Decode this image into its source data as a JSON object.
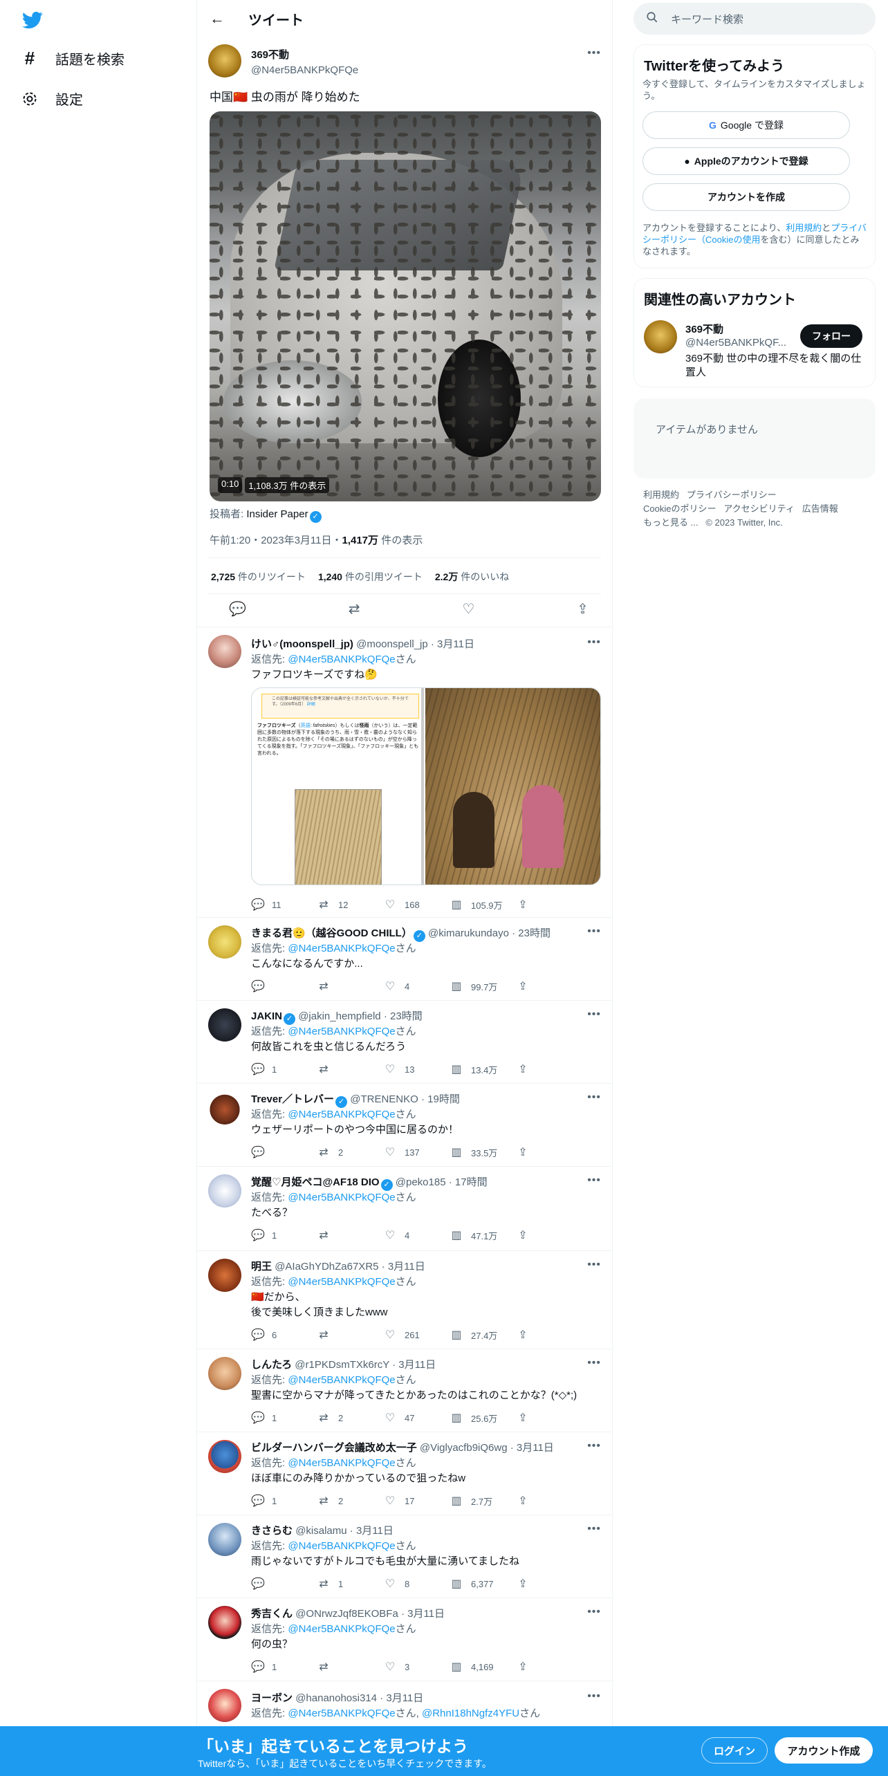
{
  "nav": {
    "explore": "話題を検索",
    "settings": "設定"
  },
  "header": {
    "title": "ツイート"
  },
  "main_tweet": {
    "name": "369不動",
    "handle": "@N4er5BANKPkQFQe",
    "text": "中国🇨🇳 虫の雨が 降り始めた",
    "video_time": "0:10",
    "video_views": "1,108.3万 件の表示",
    "poster_label": "投稿者: ",
    "poster_name": "Insider Paper",
    "timestamp": "午前1:20・2023年3月11日・",
    "views_num": "1,417万",
    "views_label": " 件の表示",
    "retweets_num": "2,725",
    "retweets_label": " 件のリツイート",
    "quotes_num": "1,240",
    "quotes_label": " 件の引用ツイート",
    "likes_num": "2.2万",
    "likes_label": " 件のいいね"
  },
  "reply_prefix": "返信先: ",
  "reply_suffix": "さん",
  "replies": [
    {
      "name": "けい♂(moonspell_jp)",
      "handle": "@moonspell_jp",
      "date": "· 3月11日",
      "reply_to": "@N4er5BANKPkQFQe",
      "text": "ファフロツキーズですね🤔",
      "replies": "11",
      "retweets": "12",
      "likes": "168",
      "views": "105.9万"
    },
    {
      "name": "きまる君🫡（越谷GOOD CHILL）",
      "handle": "@kimarukundayo",
      "date": "· 23時間",
      "reply_to": "@N4er5BANKPkQFQe",
      "text": "こんなになるんですか...",
      "replies": "",
      "retweets": "",
      "likes": "4",
      "views": "99.7万"
    },
    {
      "name": "JAKIN",
      "handle": "@jakin_hempfield",
      "date": "· 23時間",
      "reply_to": "@N4er5BANKPkQFQe",
      "text": "何故皆これを虫と信じるんだろう",
      "replies": "1",
      "retweets": "",
      "likes": "13",
      "views": "13.4万"
    },
    {
      "name": "Trever／トレバー",
      "handle": "@TRENENKO",
      "date": "· 19時間",
      "reply_to": "@N4er5BANKPkQFQe",
      "text": "ウェザーリポートのやつ今中国に居るのか！",
      "replies": "",
      "retweets": "2",
      "likes": "137",
      "views": "33.5万"
    },
    {
      "name": "覚醒♡月姫ペコ@AF18 DIO",
      "handle": "@peko185",
      "date": "· 17時間",
      "reply_to": "@N4er5BANKPkQFQe",
      "text": "たべる？",
      "replies": "1",
      "retweets": "",
      "likes": "4",
      "views": "47.1万"
    },
    {
      "name": "明王",
      "handle": "@AIaGhYDhZa67XR5",
      "date": "· 3月11日",
      "reply_to": "@N4er5BANKPkQFQe",
      "text": "🇨🇳だから、",
      "text2": "後で美味しく頂きましたwww",
      "replies": "6",
      "retweets": "",
      "likes": "261",
      "views": "27.4万"
    },
    {
      "name": "しんたろ",
      "handle": "@r1PKDsmTXk6rcY",
      "date": "· 3月11日",
      "reply_to": "@N4er5BANKPkQFQe",
      "text": "聖書に空からマナが降ってきたとかあったのはこれのことかな？(*◇*;)",
      "replies": "1",
      "retweets": "2",
      "likes": "47",
      "views": "25.6万"
    },
    {
      "name": "ビルダーハンバーグ会議改め太一子",
      "handle": "@Viglyacfb9iQ6wg",
      "date": "· 3月11日",
      "reply_to": "@N4er5BANKPkQFQe",
      "text": "ほぼ車にのみ降りかかっているので狙ったねw",
      "replies": "1",
      "retweets": "2",
      "likes": "17",
      "views": "2.7万"
    },
    {
      "name": "きさらむ",
      "handle": "@kisalamu",
      "date": "· 3月11日",
      "reply_to": "@N4er5BANKPkQFQe",
      "text": "雨じゃないですがトルコでも毛虫が大量に湧いてましたね",
      "replies": "",
      "retweets": "1",
      "likes": "8",
      "views": "6,377"
    },
    {
      "name": "秀吉くん",
      "handle": "@ONrwzJqf8EKOBFa",
      "date": "· 3月11日",
      "reply_to": "@N4er5BANKPkQFQe",
      "text": "何の虫？",
      "replies": "1",
      "retweets": "",
      "likes": "3",
      "views": "4,169"
    },
    {
      "name": "ヨーボン",
      "handle": "@hananohosi314",
      "date": "· 3月11日",
      "reply_to": "@N4er5BANKPkQFQe",
      "reply_to2": "@RhnI18hNgfz4YFU",
      "text": "",
      "replies": "",
      "retweets": "",
      "likes": "",
      "views": ""
    }
  ],
  "wiki_card": {
    "notice": "この記事は検証可能な参考文献や出典が全く示されていないか、不十分です。（2009年6月）",
    "notice_link": "詳細",
    "term": "ファフロツキーズ",
    "lang_label": "英語",
    "term_en": "fafrotskies",
    "mid_text": "）もしくは",
    "term_jp": "怪雨",
    "body": "（かいう）は、一定範囲に多数の物体が落下する現象のうち、雨・雪・雹・霰のようななく知られた原因によるものを除く「その場にあるはずのないもの」が空から降ってくる現象を指す。「ファフロツキーズ現象」、「ファフロッキー現象」とも言われる。"
  },
  "sidebar": {
    "search_placeholder": "キーワード検索",
    "signup_title": "Twitterを使ってみよう",
    "signup_sub": "今すぐ登録して、タイムラインをカスタマイズしましょう。",
    "google_btn": "Google で登録",
    "apple_btn": "Appleのアカウントで登録",
    "create_btn": "アカウントを作成",
    "terms_a": "アカウントを登録することにより、",
    "terms_link1": "利用規約",
    "terms_b": "と",
    "terms_link2": "プライバシーポリシー（Cookieの使用",
    "terms_c": "を含む）に同意したとみなされます。",
    "related_title": "関連性の高いアカウント",
    "related_name": "369不動",
    "related_handle": "@N4er5BANKPkQF...",
    "related_bio": "369不動 世の中の理不尽を裁く闇の仕置人",
    "follow_btn": "フォロー",
    "trends_empty": "アイテムがありません",
    "footer1": "利用規約",
    "footer2": "プライバシーポリシー",
    "footer3": "Cookieのポリシー",
    "footer4": "アクセシビリティ",
    "footer5": "広告情報",
    "footer6": "もっと見る ...",
    "copyright": "© 2023 Twitter, Inc."
  },
  "banner": {
    "title": "「いま」起きていることを見つけよう",
    "sub": "Twitterなら、「いま」起きていることをいち早くチェックできます。",
    "login": "ログイン",
    "signup": "アカウント作成"
  },
  "colors": {
    "accent": "#1d9bf0",
    "text": "#0f1419",
    "muted": "#536471"
  }
}
